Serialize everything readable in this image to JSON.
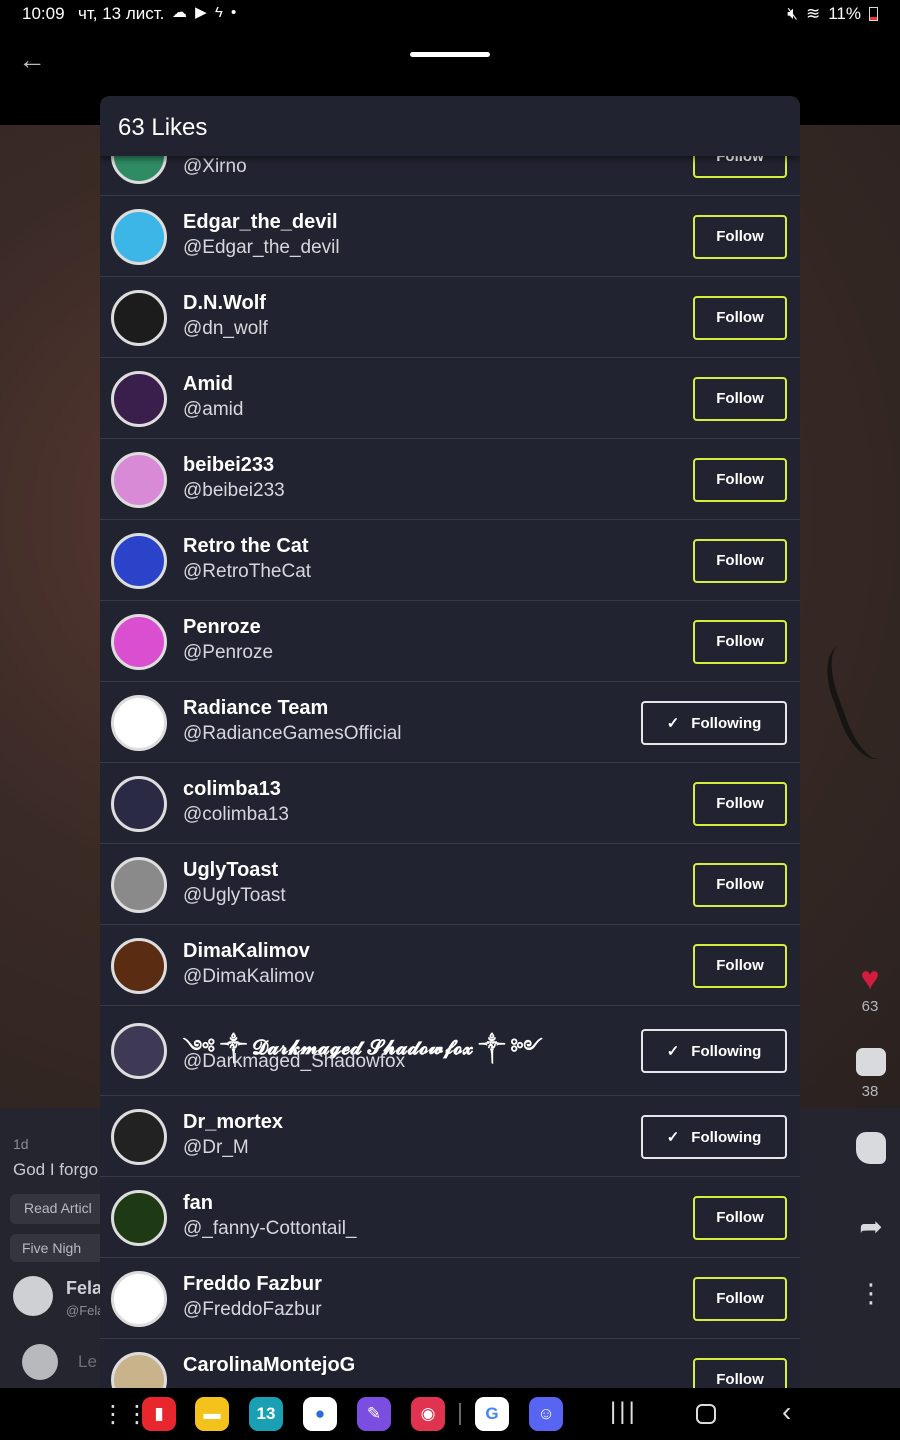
{
  "status_bar": {
    "time": "10:09",
    "date": "чт, 13 лист.",
    "notification_icons": "☁ ▶ ϟ •",
    "battery": "11%"
  },
  "post": {
    "time_ago": "1d",
    "text_preview": "God I forgo",
    "read_article": "Read Articl",
    "community": "Five Nigh",
    "author_name": "Fela",
    "author_handle": "@Fela",
    "comment_placeholder": "Le",
    "likes_count": "63",
    "comments_count": "38"
  },
  "sheet": {
    "title": "63 Likes",
    "users": [
      {
        "name": "",
        "handle": "@Xirno",
        "button": "Follow",
        "following": false,
        "avatar_color": "#2f8b63"
      },
      {
        "name": "Edgar_the_devil",
        "handle": "@Edgar_the_devil",
        "button": "Follow",
        "following": false,
        "avatar_color": "#3bb6e6"
      },
      {
        "name": "D.N.Wolf",
        "handle": "@dn_wolf",
        "button": "Follow",
        "following": false,
        "avatar_color": "#1c1c1c"
      },
      {
        "name": "Amid",
        "handle": "@amid",
        "button": "Follow",
        "following": false,
        "avatar_color": "#3a1f4d"
      },
      {
        "name": "beibei233",
        "handle": "@beibei233",
        "button": "Follow",
        "following": false,
        "avatar_color": "#d88ad6"
      },
      {
        "name": "Retro the Cat",
        "handle": "@RetroTheCat",
        "button": "Follow",
        "following": false,
        "avatar_color": "#2a43c9"
      },
      {
        "name": "Penroze",
        "handle": "@Penroze",
        "button": "Follow",
        "following": false,
        "avatar_color": "#d94fcf"
      },
      {
        "name": "Radiance Team",
        "handle": "@RadianceGamesOfficial",
        "button": "Following",
        "following": true,
        "avatar_color": "#ffffff"
      },
      {
        "name": "colimba13",
        "handle": "@colimba13",
        "button": "Follow",
        "following": false,
        "avatar_color": "#2b2a45"
      },
      {
        "name": "UglyToast",
        "handle": "@UglyToast",
        "button": "Follow",
        "following": false,
        "avatar_color": "#8a8a8a"
      },
      {
        "name": "DimaKalimov",
        "handle": "@DimaKalimov",
        "button": "Follow",
        "following": false,
        "avatar_color": "#5a2c12"
      },
      {
        "name": "༺ ༒ 𝓓𝓪𝓻𝓴𝓶𝓪𝓰𝓮𝓭 𝓢𝓱𝓪𝓭𝓸𝔀𝓯𝓸𝔁 ༒ ༻",
        "handle": "@Darkmaged_Shadowfox",
        "button": "Following",
        "following": true,
        "avatar_color": "#3e3a55"
      },
      {
        "name": "Dr_mortex",
        "handle": "@Dr_M",
        "button": "Following",
        "following": true,
        "avatar_color": "#222222"
      },
      {
        "name": "fan",
        "handle": "@_fanny-Cottontail_",
        "button": "Follow",
        "following": false,
        "avatar_color": "#1e3a14"
      },
      {
        "name": "Freddo Fazbur",
        "handle": "@FreddoFazbur",
        "button": "Follow",
        "following": false,
        "avatar_color": "#ffffff"
      },
      {
        "name": "CarolinaMontejoG",
        "handle": "",
        "button": "Follow",
        "following": false,
        "avatar_color": "#c9b38a"
      }
    ]
  },
  "nav_bar": {
    "apps_grid": "⋮⋮⋮",
    "apps": [
      {
        "name": "flipboard",
        "glyph": "▮",
        "bg": "#e8262e",
        "fg": "#ffffff"
      },
      {
        "name": "files",
        "glyph": "▬",
        "bg": "#f3c21b",
        "fg": "#ffffff"
      },
      {
        "name": "calendar",
        "glyph": "13",
        "bg": "#1a9fb3",
        "fg": "#ffffff"
      },
      {
        "name": "messages",
        "glyph": "●",
        "bg": "#ffffff",
        "fg": "#2a6cd8"
      },
      {
        "name": "notes",
        "glyph": "✎",
        "bg": "#7b4de0",
        "fg": "#ffffff"
      },
      {
        "name": "camera",
        "glyph": "◉",
        "bg": "#e0334f",
        "fg": "#ffffff"
      },
      {
        "name": "google",
        "glyph": "G",
        "bg": "#ffffff",
        "fg": "#4285f4"
      },
      {
        "name": "discord",
        "glyph": "☺",
        "bg": "#5865f2",
        "fg": "#ffffff"
      }
    ],
    "recents": "|||",
    "back": "‹"
  }
}
